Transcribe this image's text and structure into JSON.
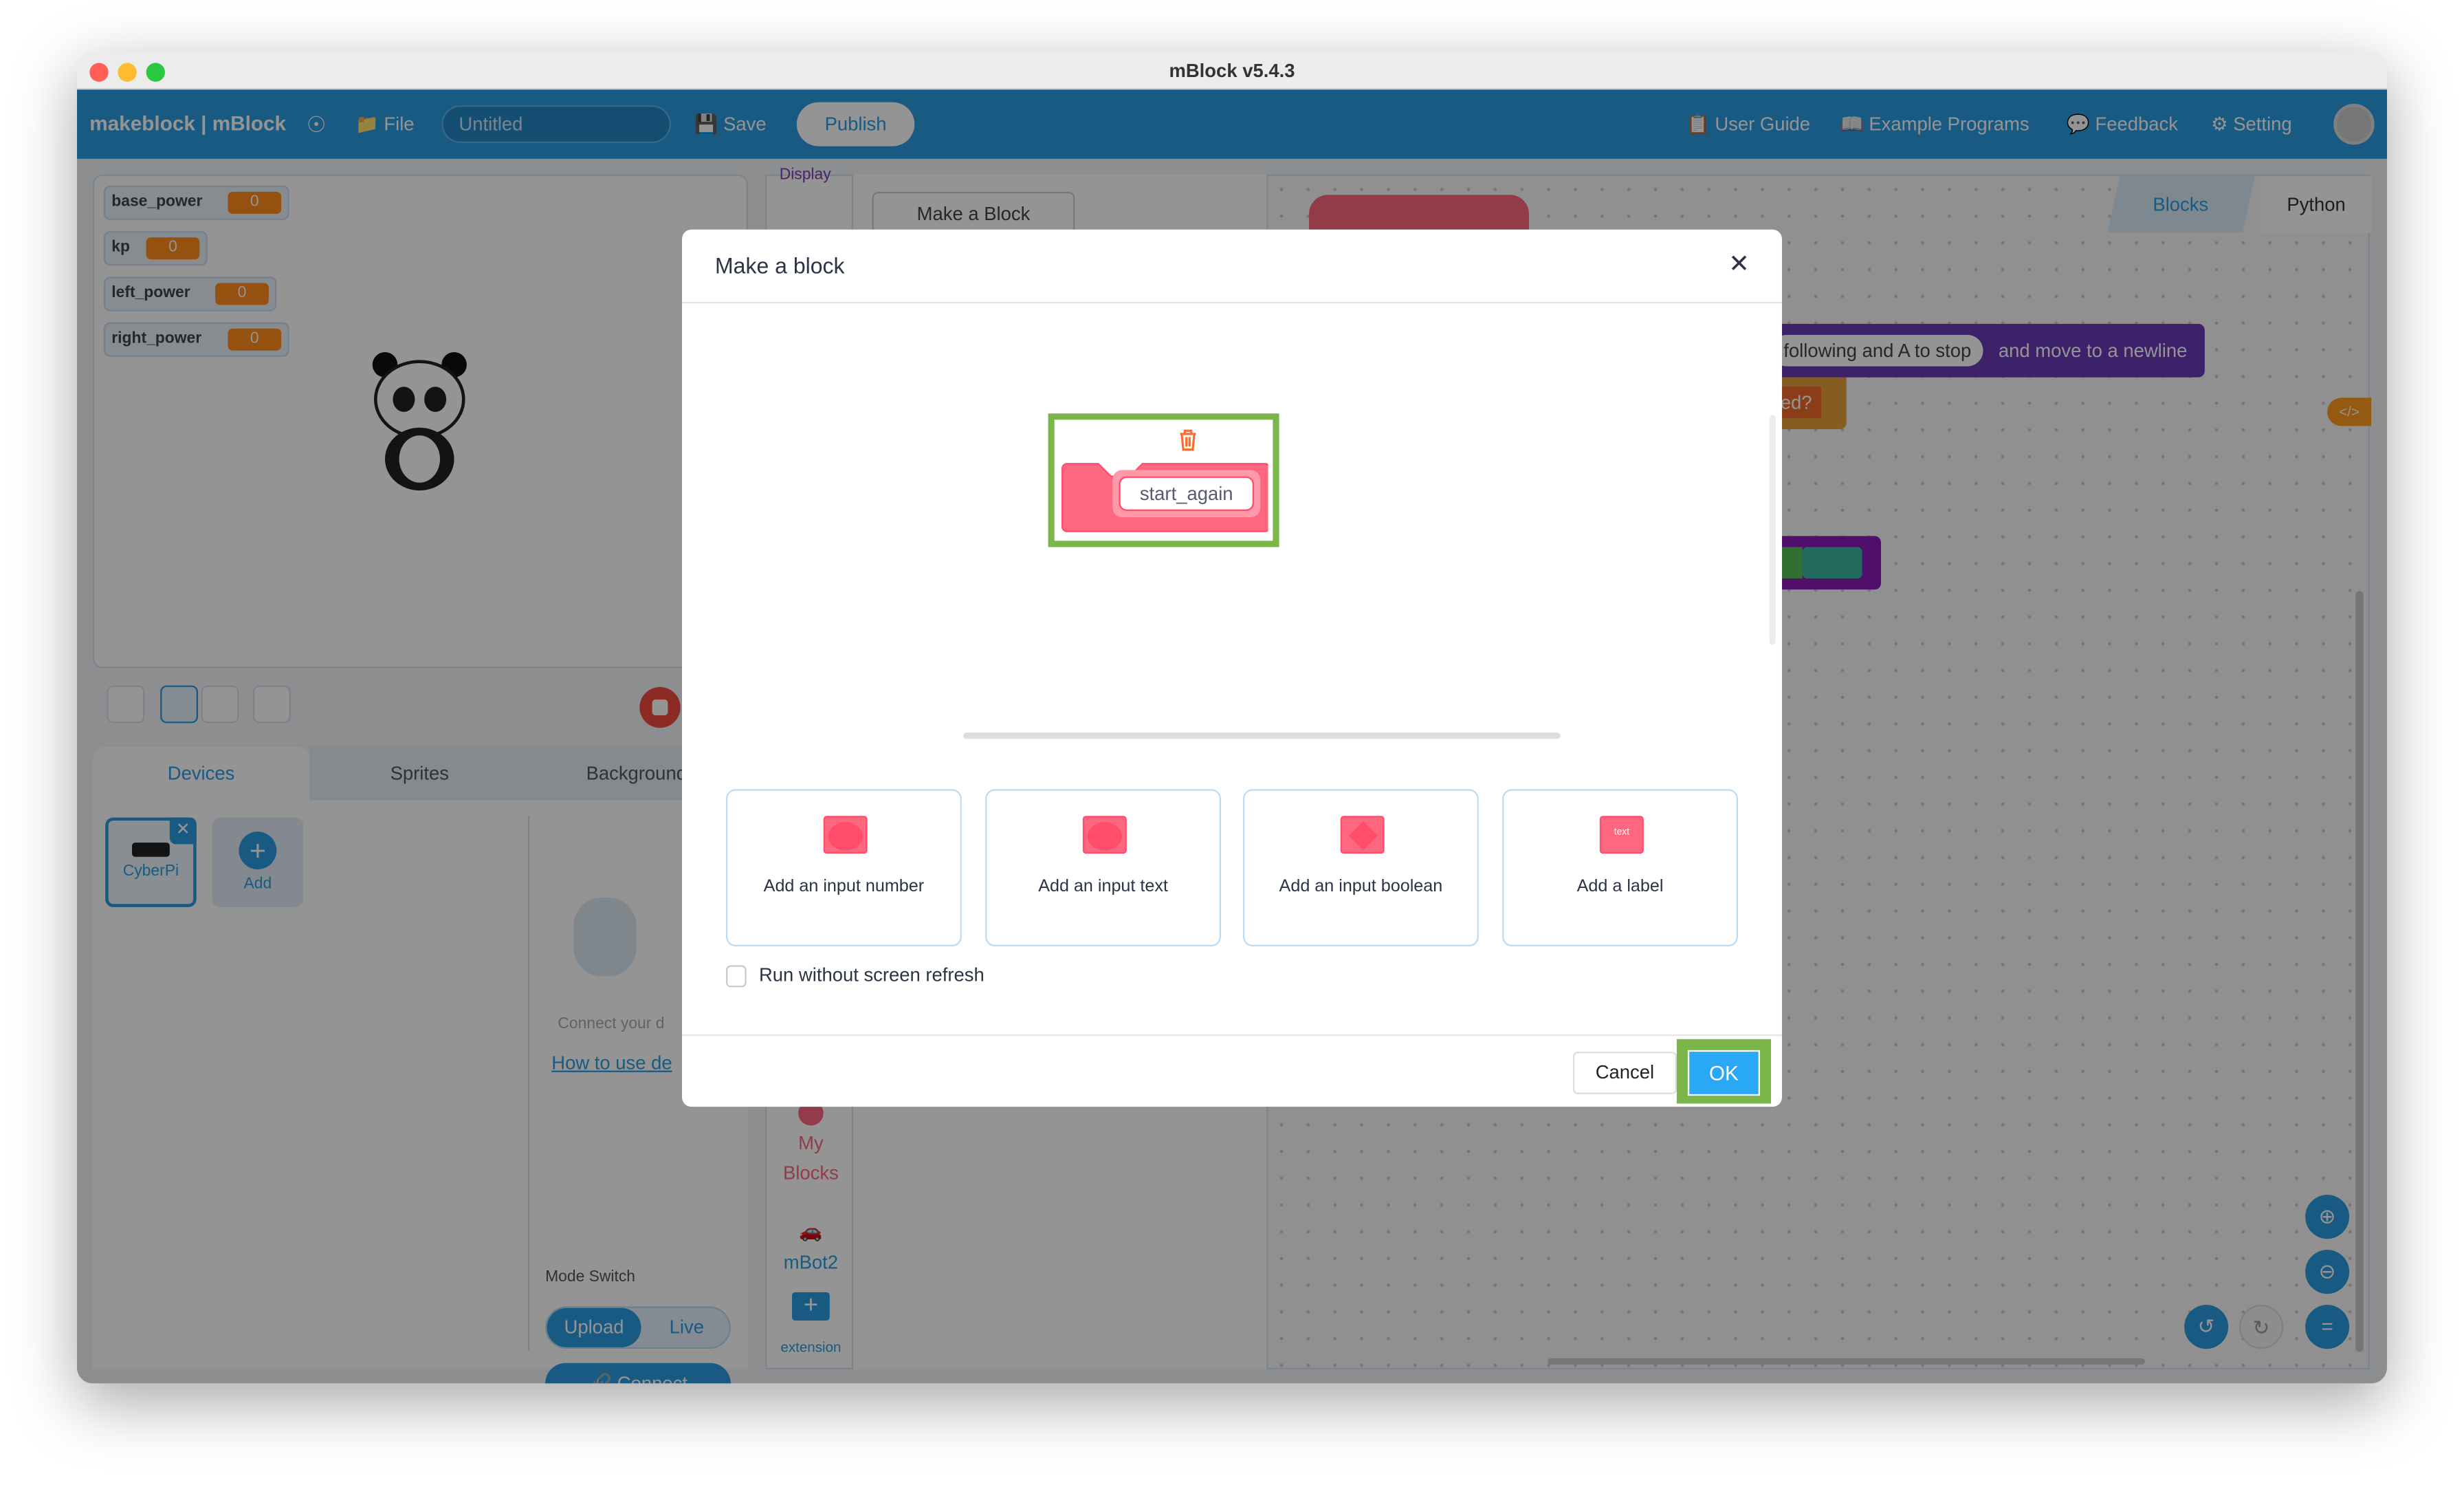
{
  "window": {
    "title": "mBlock v5.4.3"
  },
  "toolbar": {
    "logo": "makeblock | mBlock",
    "file": "File",
    "project_name": "Untitled",
    "save": "Save",
    "publish": "Publish",
    "user_guide": "User Guide",
    "examples": "Example Programs",
    "feedback": "Feedback",
    "setting": "Setting"
  },
  "variables": [
    {
      "name": "base_power",
      "value": "0"
    },
    {
      "name": "kp",
      "value": "0"
    },
    {
      "name": "left_power",
      "value": "0"
    },
    {
      "name": "right_power",
      "value": "0"
    }
  ],
  "tabs": {
    "devices": "Devices",
    "sprites": "Sprites",
    "background": "Background"
  },
  "devices": {
    "items": [
      "CyberPi"
    ],
    "add": "Add",
    "connect_hint": "Connect your d",
    "help_link": "How to use de",
    "mode_switch": "Mode Switch",
    "upload": "Upload",
    "live": "Live",
    "connect": "Connect"
  },
  "palette": {
    "top_category": "Display",
    "my_blocks": "My Blocks",
    "mbot2": "mBot2",
    "extension": "extension",
    "make_block": "Make a Block"
  },
  "editor": {
    "tab_blocks": "Blocks",
    "tab_python": "Python",
    "block_text_1": "following and A to stop",
    "block_text_2": "and move to a newline",
    "block_text_3": "ed?",
    "code_toggle": "</>"
  },
  "dialog": {
    "title": "Make a block",
    "block_name": "start_again",
    "options": [
      {
        "label": "Add an input number",
        "icon": "number-input"
      },
      {
        "label": "Add an input text",
        "icon": "text-input"
      },
      {
        "label": "Add an input boolean",
        "icon": "boolean-input"
      },
      {
        "label": "Add a label",
        "icon": "label",
        "icon_text": "text"
      }
    ],
    "run_without_refresh": "Run without screen refresh",
    "run_without_refresh_checked": false,
    "cancel": "Cancel",
    "ok": "OK"
  },
  "colors": {
    "brand_blue": "#2b9be0",
    "myblocks_pink": "#ff6680",
    "highlight_green": "#7ab648",
    "ok_blue": "#29a9f5"
  }
}
